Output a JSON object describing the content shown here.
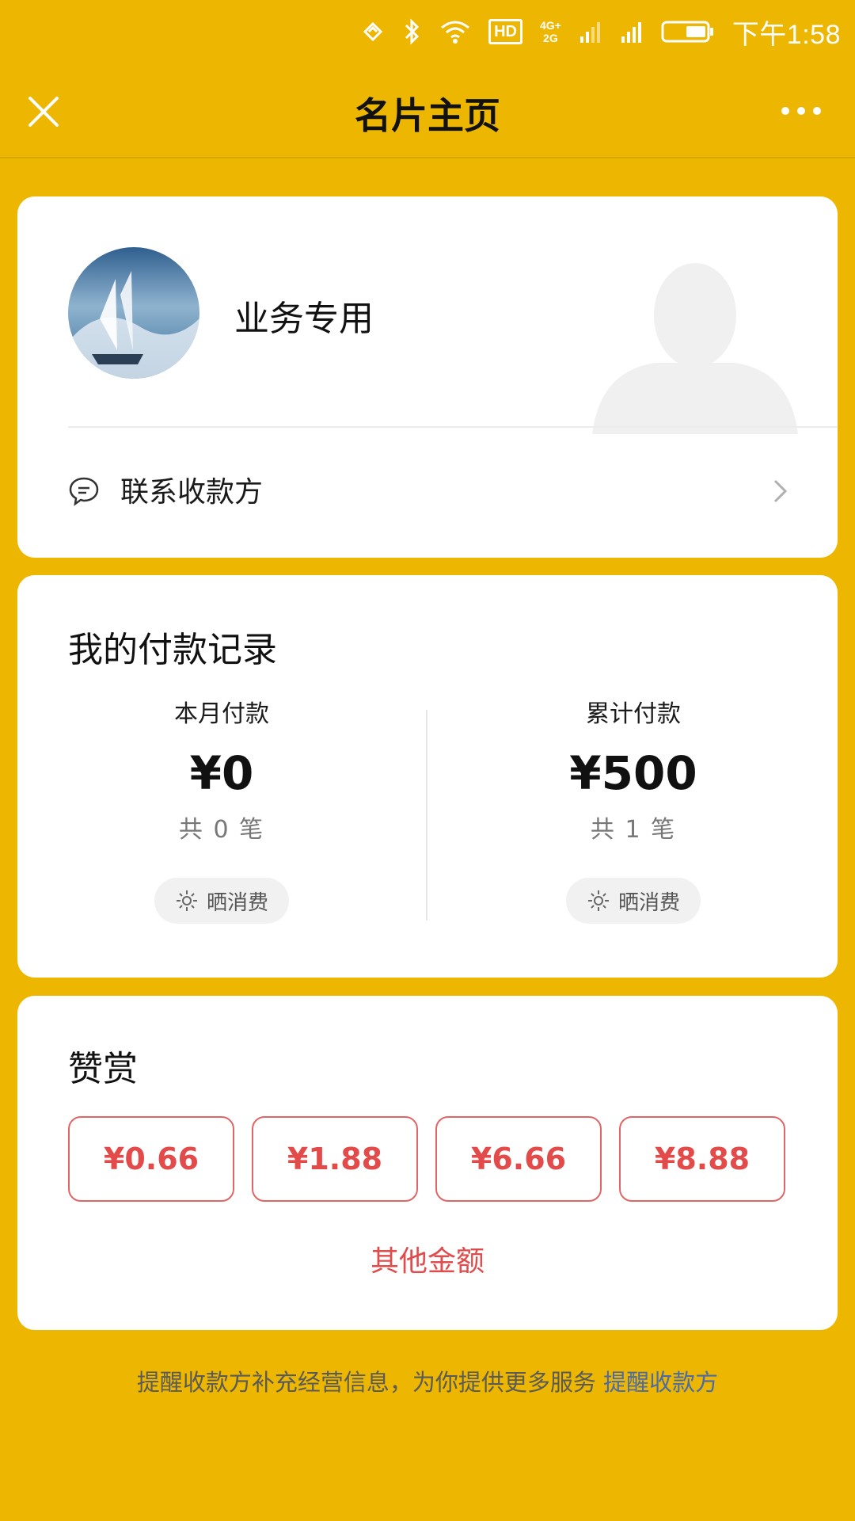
{
  "status_bar": {
    "time": "下午1:58",
    "hd": "HD",
    "network_top": "4G+",
    "network_bottom": "2G",
    "icons": [
      "nfc-icon",
      "bluetooth-icon",
      "wifi-icon",
      "hd-icon",
      "signal-icon",
      "signal-icon",
      "battery-icon"
    ]
  },
  "nav": {
    "title": "名片主页",
    "close_icon": "close-icon",
    "more_icon": "more-icon"
  },
  "profile": {
    "name": "业务专用",
    "contact_label": "联系收款方"
  },
  "records": {
    "title": "我的付款记录",
    "month": {
      "label": "本月付款",
      "amount": "¥0",
      "count": "共 0 笔",
      "show_label": "晒消费"
    },
    "total": {
      "label": "累计付款",
      "amount": "¥500",
      "count": "共 1 笔",
      "show_label": "晒消费"
    }
  },
  "tip": {
    "title": "赞赏",
    "amounts": [
      "¥0.66",
      "¥1.88",
      "¥6.66",
      "¥8.88"
    ],
    "other_label": "其他金额"
  },
  "footer": {
    "text": "提醒收款方补充经营信息，为你提供更多服务",
    "link": "提醒收款方"
  },
  "colors": {
    "background": "#EDB600",
    "card": "#FFFFFF",
    "accent_red": "#E34B4B",
    "link_blue": "#4A6BA8"
  }
}
